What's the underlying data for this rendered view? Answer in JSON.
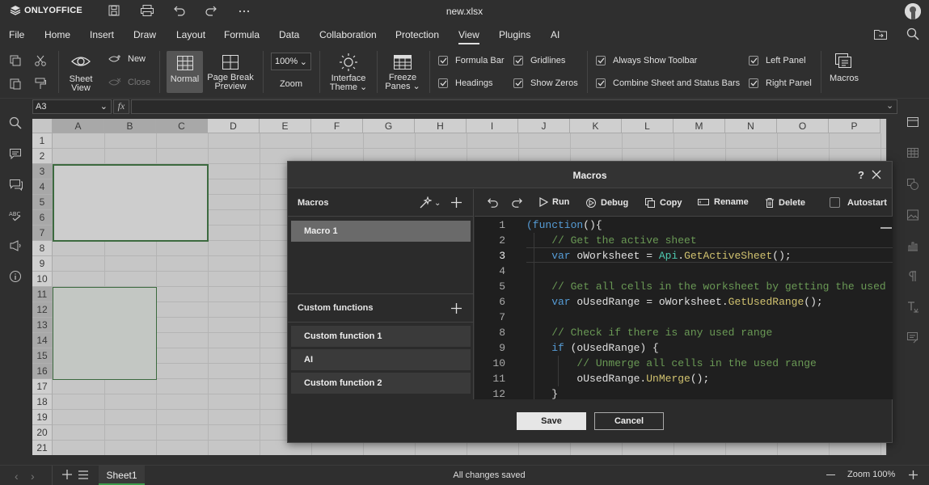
{
  "app": {
    "logo_text": "ONLYOFFICE",
    "doc_title": "new.xlsx"
  },
  "menu": [
    "File",
    "Home",
    "Insert",
    "Draw",
    "Layout",
    "Formula",
    "Data",
    "Collaboration",
    "Protection",
    "View",
    "Plugins",
    "AI"
  ],
  "menu_active": "View",
  "ribbon": {
    "sheet_view": "Sheet",
    "sheet_view2": "View",
    "new": "New",
    "close": "Close",
    "normal": "Normal",
    "page_break": "Page Break",
    "page_break2": "Preview",
    "zoom_value": "100%",
    "zoom": "Zoom",
    "interface_theme": "Interface",
    "interface_theme2": "Theme",
    "freeze_panes": "Freeze",
    "freeze_panes2": "Panes",
    "formula_bar": "Formula Bar",
    "headings": "Headings",
    "gridlines": "Gridlines",
    "show_zeros": "Show Zeros",
    "always_show_toolbar": "Always Show Toolbar",
    "combine_bars": "Combine Sheet and Status Bars",
    "left_panel": "Left Panel",
    "right_panel": "Right Panel",
    "macros": "Macros"
  },
  "formula": {
    "name_box": "A3",
    "fx": "fx"
  },
  "columns": [
    "A",
    "B",
    "C",
    "D",
    "E",
    "F",
    "G",
    "H",
    "I",
    "J",
    "K",
    "L",
    "M",
    "N",
    "O",
    "P"
  ],
  "rows": [
    "1",
    "2",
    "3",
    "4",
    "5",
    "6",
    "7",
    "8",
    "9",
    "10",
    "11",
    "12",
    "13",
    "14",
    "15",
    "16",
    "17",
    "18",
    "19",
    "20",
    "21"
  ],
  "dialog": {
    "title": "Macros",
    "help": "?",
    "macros_header": "Macros",
    "macros": [
      "Macro 1"
    ],
    "custom_header": "Custom functions",
    "custom_functions": [
      "Custom function 1",
      "AI",
      "Custom function 2"
    ],
    "toolbar": {
      "run": "Run",
      "debug": "Debug",
      "copy": "Copy",
      "rename": "Rename",
      "delete": "Delete",
      "autostart": "Autostart"
    },
    "line_numbers": [
      "1",
      "2",
      "3",
      "4",
      "5",
      "6",
      "7",
      "8",
      "9",
      "10",
      "11",
      "12"
    ],
    "save": "Save",
    "cancel": "Cancel"
  },
  "status": {
    "sheet_tab": "Sheet1",
    "message": "All changes saved",
    "zoom": "Zoom 100%"
  }
}
